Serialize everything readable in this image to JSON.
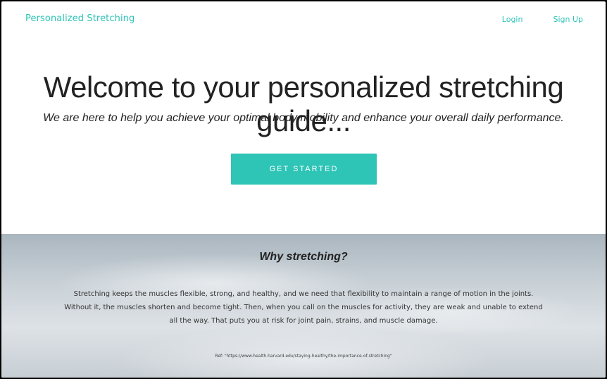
{
  "navbar": {
    "brand": "Personalized Stretching",
    "login_label": "Login",
    "signup_label": "Sign Up"
  },
  "hero": {
    "title": "Welcome to your personalized stretching guide...",
    "subtitle": "We are here to help you achieve your optimal body mobility and enhance your overall daily performance.",
    "cta_label": "GET STARTED"
  },
  "why": {
    "title": "Why stretching?",
    "body": "Stretching keeps the muscles flexible, strong, and healthy, and we need that flexibility to maintain a range of motion in the joints. Without it, the muscles shorten and become tight. Then, when you call on the muscles for activity, they are weak and unable to extend all the way. That puts you at risk for joint pain, strains, and muscle damage.",
    "reference": "Ref: \"https://www.health.harvard.edu/staying-healthy/the-importance-of-stretching\""
  },
  "colors": {
    "accent": "#2ec4b6",
    "text_dark": "#222222"
  }
}
